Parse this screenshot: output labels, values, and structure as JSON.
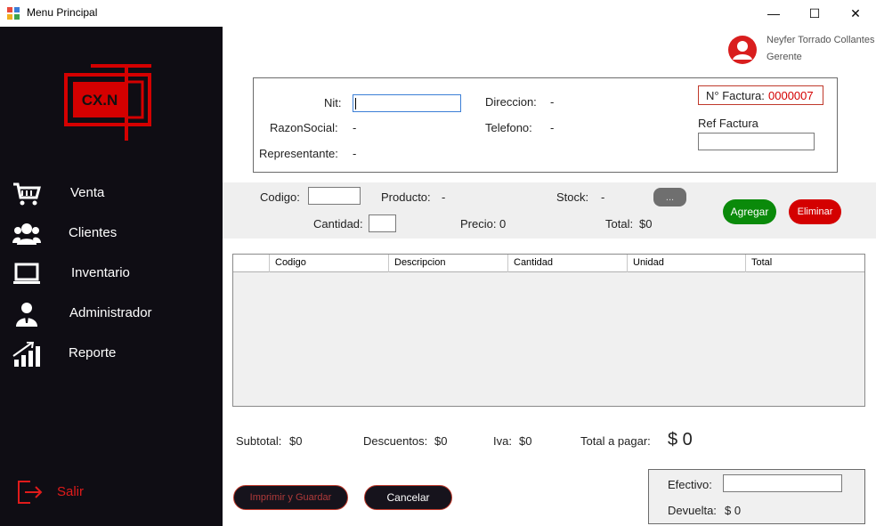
{
  "window": {
    "title": "Menu Principal",
    "app_icon": "app-icon",
    "controls": [
      "minimize-icon",
      "maximize-icon",
      "close-icon"
    ],
    "minimize_glyph": "—",
    "maximize_glyph": "☐",
    "close_glyph": "✕"
  },
  "logo": {
    "text": "CX.N",
    "color": "#d40000"
  },
  "sidebar": {
    "items": [
      {
        "label": "Venta",
        "icon": "cart-icon"
      },
      {
        "label": "Clientes",
        "icon": "users-icon"
      },
      {
        "label": "Inventario",
        "icon": "laptop-icon"
      },
      {
        "label": "Administrador",
        "icon": "admin-icon"
      },
      {
        "label": "Reporte",
        "icon": "chart-icon"
      }
    ],
    "exit_label": "Salir",
    "exit_icon": "exit-icon"
  },
  "user": {
    "name": "Neyfer Torrado Collantes",
    "role": "Gerente",
    "icon": "user-avatar-icon"
  },
  "client": {
    "nit_label": "Nit:",
    "nit_value": "",
    "razon_label": "RazonSocial:",
    "razon_value": "-",
    "representante_label": "Representante:",
    "representante_value": "-",
    "direccion_label": "Direccion:",
    "direccion_value": "-",
    "telefono_label": "Telefono:",
    "telefono_value": "-"
  },
  "factura": {
    "label": "N° Factura:",
    "number": "0000007",
    "ref_label": "Ref Factura",
    "ref_value": ""
  },
  "product": {
    "codigo_label": "Codigo:",
    "producto_label": "Producto:",
    "producto_value": "-",
    "stock_label": "Stock:",
    "stock_value": "-",
    "search_button": "...",
    "cantidad_label": "Cantidad:",
    "precio_label": "Precio:",
    "precio_value": "0",
    "total_label": "Total:",
    "total_value": "$0",
    "add_button": "Agregar",
    "delete_button": "Eliminar"
  },
  "grid": {
    "columns": [
      "Codigo",
      "Descripcion",
      "Cantidad",
      "Unidad",
      "Total"
    ]
  },
  "summary": {
    "subtotal_label": "Subtotal:",
    "subtotal_value": "$0",
    "descuentos_label": "Descuentos:",
    "descuentos_value": "$0",
    "iva_label": "Iva:",
    "iva_value": "$0",
    "total_pagar_label": "Total a pagar:",
    "total_pagar_value": "$ 0"
  },
  "actions": {
    "print_save": "Imprimir y Guardar",
    "cancel": "Cancelar"
  },
  "payment": {
    "efectivo_label": "Efectivo:",
    "efectivo_value": "",
    "devuelta_label": "Devuelta:",
    "devuelta_value": "$ 0"
  },
  "colors": {
    "accent_red": "#d40000",
    "sidebar_bg": "#0f0d14",
    "green": "#0a8a0a"
  }
}
